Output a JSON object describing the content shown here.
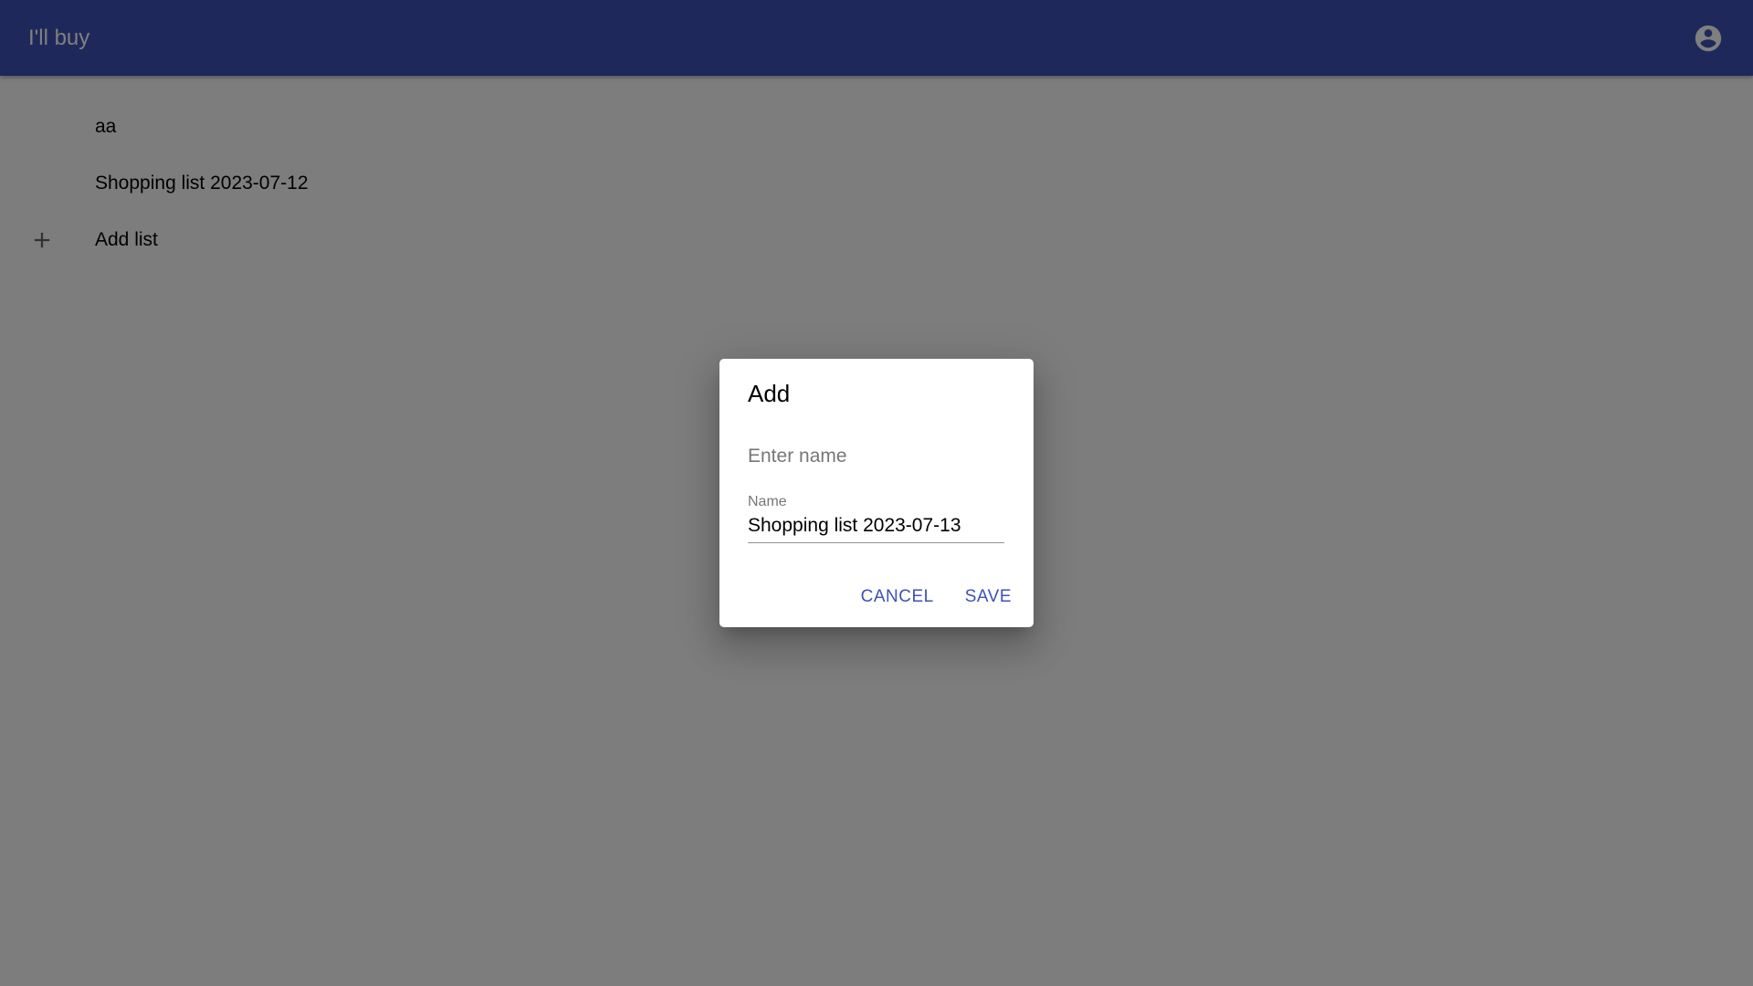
{
  "app_bar": {
    "title": "I'll buy",
    "account_icon": "account-circle-icon",
    "color": "#3f51b5"
  },
  "lists": {
    "items": [
      {
        "label": "aa"
      },
      {
        "label": "Shopping list 2023-07-12"
      }
    ],
    "add_item": {
      "icon": "plus-icon",
      "label": "Add list"
    }
  },
  "dialog": {
    "title": "Add",
    "text": "Enter name",
    "field": {
      "label": "Name",
      "value": "Shopping list 2023-07-13"
    },
    "actions": {
      "cancel_label": "CANCEL",
      "save_label": "SAVE"
    },
    "accent_color": "#3f51b5"
  }
}
